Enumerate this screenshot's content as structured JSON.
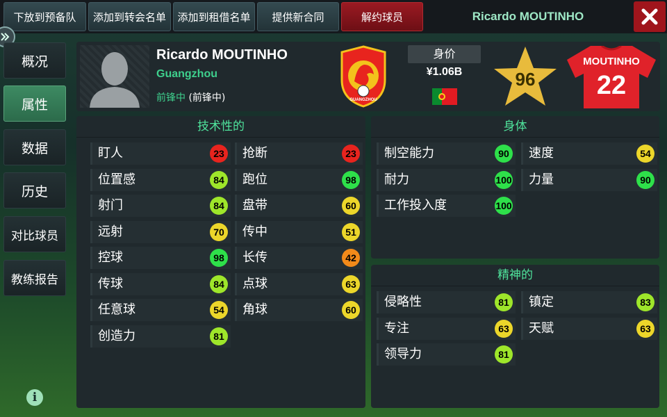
{
  "topbar": {
    "buttons": [
      "下放到预备队",
      "添加到转会名单",
      "添加到租借名单",
      "提供新合同",
      "解约球员"
    ],
    "title": "Ricardo MOUTINHO"
  },
  "sidebar": {
    "items": [
      "概况",
      "属性",
      "数据",
      "历史",
      "对比球员",
      "教练报告"
    ]
  },
  "player": {
    "name": "Ricardo MOUTINHO",
    "club": "Guangzhou",
    "position_label": "前锋中",
    "position_detail": "(前锋中)",
    "value_label": "身价",
    "value": "¥1.06B",
    "nationality_flag": "portugal-flag",
    "rating": "96",
    "shirt_name": "MOUTINHO",
    "shirt_number": "22",
    "crest_text": "GUANGZHOU"
  },
  "colors": {
    "red": "#e8241e",
    "orange": "#f28a1a",
    "yellow": "#ecd62a",
    "lightgreen": "#9ee62a",
    "green": "#2ee04a",
    "accent": "#4fe39c"
  },
  "technical": {
    "title": "技术性的",
    "left": [
      {
        "name": "盯人",
        "value": "23"
      },
      {
        "name": "位置感",
        "value": "84"
      },
      {
        "name": "射门",
        "value": "84"
      },
      {
        "name": "远射",
        "value": "70"
      },
      {
        "name": "控球",
        "value": "98"
      },
      {
        "name": "传球",
        "value": "84"
      },
      {
        "name": "任意球",
        "value": "54"
      },
      {
        "name": "创造力",
        "value": "81"
      }
    ],
    "right": [
      {
        "name": "抢断",
        "value": "23"
      },
      {
        "name": "跑位",
        "value": "98"
      },
      {
        "name": "盘带",
        "value": "60"
      },
      {
        "name": "传中",
        "value": "51"
      },
      {
        "name": "长传",
        "value": "42"
      },
      {
        "name": "点球",
        "value": "63"
      },
      {
        "name": "角球",
        "value": "60"
      }
    ]
  },
  "physical": {
    "title": "身体",
    "left": [
      {
        "name": "制空能力",
        "value": "90"
      },
      {
        "name": "耐力",
        "value": "100"
      },
      {
        "name": "工作投入度",
        "value": "100"
      }
    ],
    "right": [
      {
        "name": "速度",
        "value": "54"
      },
      {
        "name": "力量",
        "value": "90"
      }
    ]
  },
  "mental": {
    "title": "精神的",
    "left": [
      {
        "name": "侵略性",
        "value": "81"
      },
      {
        "name": "专注",
        "value": "63"
      },
      {
        "name": "领导力",
        "value": "81"
      }
    ],
    "right": [
      {
        "name": "镇定",
        "value": "83"
      },
      {
        "name": "天赋",
        "value": "63"
      }
    ]
  }
}
